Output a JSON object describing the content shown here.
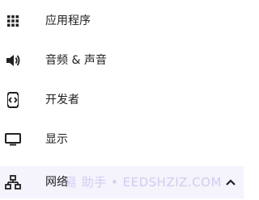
{
  "menu": {
    "items": [
      {
        "label": "应用程序",
        "icon": "apps-grid-icon"
      },
      {
        "label": "音频 & 声音",
        "icon": "volume-icon"
      },
      {
        "label": "开发者",
        "icon": "developer-icon"
      },
      {
        "label": "显示",
        "icon": "monitor-icon"
      },
      {
        "label": "网络",
        "icon": "network-icon",
        "expanded": true
      }
    ]
  },
  "watermark": "易 助手 • EEDSHZIZ.COM",
  "colors": {
    "text": "#202124",
    "icon": "#202124",
    "highlight": "#f5f3fb"
  }
}
